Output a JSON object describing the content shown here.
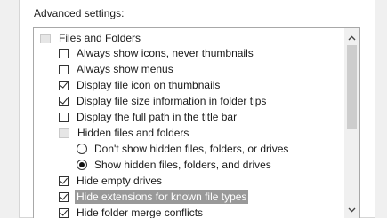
{
  "advanced_label": "Advanced settings:",
  "list": {
    "group_files": "Files and Folders",
    "items": [
      {
        "label": "Always show icons, never thumbnails",
        "checked": false
      },
      {
        "label": "Always show menus",
        "checked": false
      },
      {
        "label": "Display file icon on thumbnails",
        "checked": true
      },
      {
        "label": "Display file size information in folder tips",
        "checked": true
      },
      {
        "label": "Display the full path in the title bar",
        "checked": false
      }
    ],
    "group_hidden": "Hidden files and folders",
    "radios": [
      {
        "label": "Don't show hidden files, folders, or drives",
        "checked": false
      },
      {
        "label": "Show hidden files, folders, and drives",
        "checked": true
      }
    ],
    "items2": [
      {
        "label": "Hide empty drives",
        "checked": true
      },
      {
        "label": "Hide extensions for known file types",
        "checked": true,
        "selected": true
      },
      {
        "label": "Hide folder merge conflicts",
        "checked": true
      }
    ]
  },
  "scrollbar": {
    "up_icon": "chevron-up-icon",
    "down_icon": "chevron-down-icon"
  },
  "colors": {
    "selection": "#999999",
    "panel_bg": "#ffffff",
    "window_bg": "#f0f0f0"
  }
}
